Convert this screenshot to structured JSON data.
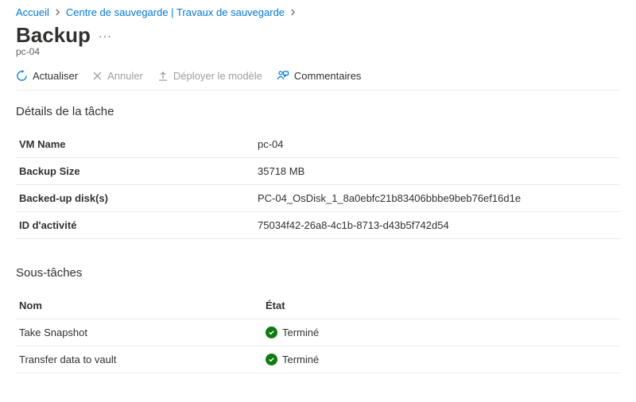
{
  "breadcrumb": {
    "home": "Accueil",
    "center": "Centre de sauvegarde | Travaux de sauvegarde"
  },
  "page": {
    "title": "Backup",
    "subtitle": "pc-04"
  },
  "toolbar": {
    "refresh": "Actualiser",
    "cancel": "Annuler",
    "deploy": "Déployer le modèle",
    "comments": "Commentaires"
  },
  "details": {
    "heading": "Détails de la tâche",
    "rows": [
      {
        "label": "VM Name",
        "value": "pc-04"
      },
      {
        "label": "Backup Size",
        "value": "35718 MB"
      },
      {
        "label": "Backed-up disk(s)",
        "value": "PC-04_OsDisk_1_8a0ebfc21b83406bbbe9beb76ef16d1e"
      },
      {
        "label": "ID d'activité",
        "value": "75034f42-26a8-4c1b-8713-d43b5f742d54"
      }
    ]
  },
  "subtasks": {
    "heading": "Sous-tâches",
    "col_name": "Nom",
    "col_state": "État",
    "rows": [
      {
        "name": "Take Snapshot",
        "state": "Terminé"
      },
      {
        "name": "Transfer data to vault",
        "state": "Terminé"
      }
    ]
  },
  "colors": {
    "link": "#0078d4",
    "success": "#107c10"
  }
}
